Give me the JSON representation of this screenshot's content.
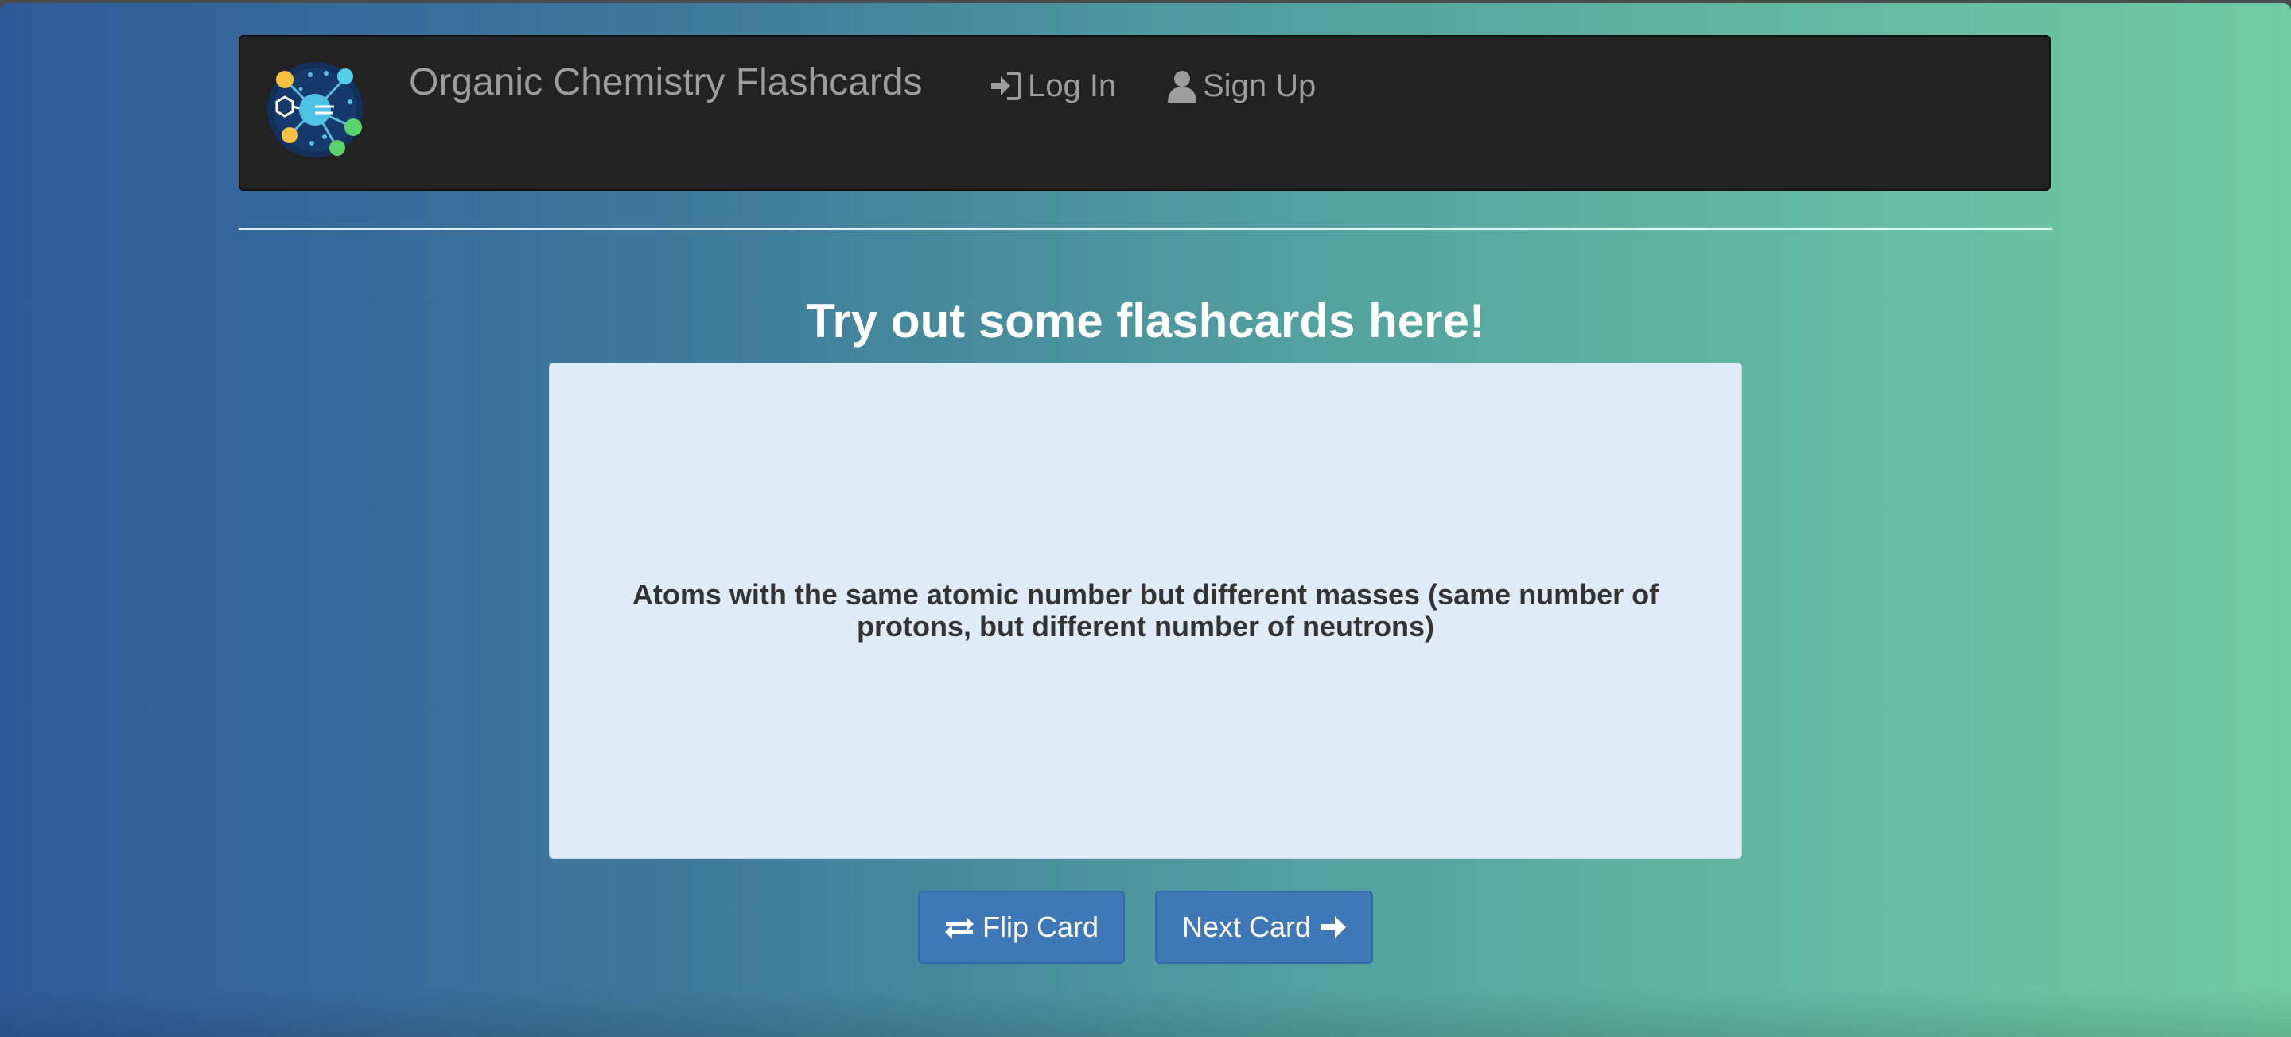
{
  "navbar": {
    "brand": "Organic Chemistry Flashcards",
    "login_label": "Log In",
    "signup_label": "Sign Up"
  },
  "main": {
    "heading": "Try out some flashcards here!",
    "card_text": "Atoms with the same atomic number but different masses (same number of protons, but different number of neutrons)",
    "flip_label": "Flip Card",
    "next_label": "Next Card"
  },
  "icons": {
    "logo": "molecule-logo-icon",
    "login": "log-in-icon",
    "signup": "user-icon",
    "flip": "swap-arrows-icon",
    "next": "arrow-right-icon"
  }
}
